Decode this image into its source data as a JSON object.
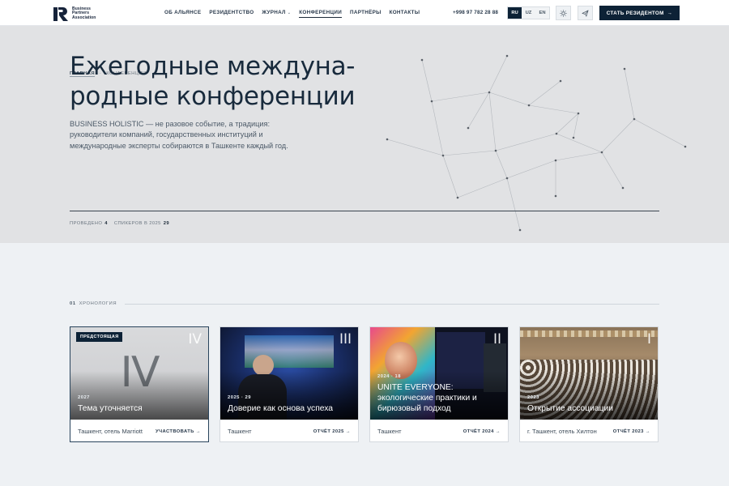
{
  "header": {
    "logo_lines": [
      "Business",
      "Partners",
      "Association"
    ],
    "nav": [
      {
        "label": "ОБ АЛЬЯНСЕ"
      },
      {
        "label": "РЕЗИДЕНТСТВО"
      },
      {
        "label": "ЖУРНАЛ",
        "chevron": "⌄"
      },
      {
        "label": "КОНФЕРЕНЦИИ",
        "active": true
      },
      {
        "label": "ПАРТНЁРЫ"
      },
      {
        "label": "КОНТАКТЫ"
      }
    ],
    "phone": "+998 97 782 28 88",
    "languages": [
      {
        "code": "RU",
        "active": true
      },
      {
        "code": "UZ"
      },
      {
        "code": "EN"
      }
    ],
    "icons": [
      "sun-icon",
      "send-icon"
    ],
    "cta_label": "СТАТЬ РЕЗИДЕНТОМ",
    "cta_arrow": "→"
  },
  "hero": {
    "breadcrumb": {
      "home": "ГЛАВНАЯ",
      "separator": "·",
      "current": "КОНФЕРЕНЦИИ"
    },
    "title": "Ежегодные междуна-родные конференции",
    "description": "BUSINESS HOLISTIC — не разовое событие, а традиция: руководители компаний, государственных институций и международные эксперты собираются в Ташкенте каждый год.",
    "stats": [
      {
        "label": "ПРОВЕДЕНО",
        "value": "4"
      },
      {
        "label": "СПИКЕРОВ В 2025",
        "value": "29"
      }
    ]
  },
  "chronology": {
    "number": "01",
    "title": "ХРОНОЛОГИЯ",
    "cards": [
      {
        "roman": "IV",
        "badge": "ПРЕДСТОЯЩАЯ",
        "year": "2027",
        "title": "Тема уточняется",
        "place": "Ташкент, отель Marriott",
        "link": "УЧАСТВОВАТЬ →",
        "media": "placeholder-gray"
      },
      {
        "roman": "III",
        "year": "2025 · 29",
        "title": "Доверие как основа успеха",
        "place": "Ташкент",
        "link": "ОТЧЁТ 2025 →",
        "media": "speaker-stage-photo"
      },
      {
        "roman": "II",
        "year": "2024 · 18",
        "title": "UNITE EVERYONE: экологические практики и бирюзовый подход",
        "place": "Ташкент",
        "link": "ОТЧЁТ 2024 →",
        "media": "colorful-portrait-stage-photo"
      },
      {
        "roman": "I",
        "year": "2023",
        "title": "Открытие ассоциации",
        "place": "г. Ташкент, отель Хилтон",
        "link": "ОТЧЁТ 2023 →",
        "media": "conference-hall-audience-photo"
      }
    ]
  },
  "colors": {
    "navy": "#0d2236",
    "hero_bg": "#e1e2e4",
    "page_bg": "#eef1f4"
  }
}
